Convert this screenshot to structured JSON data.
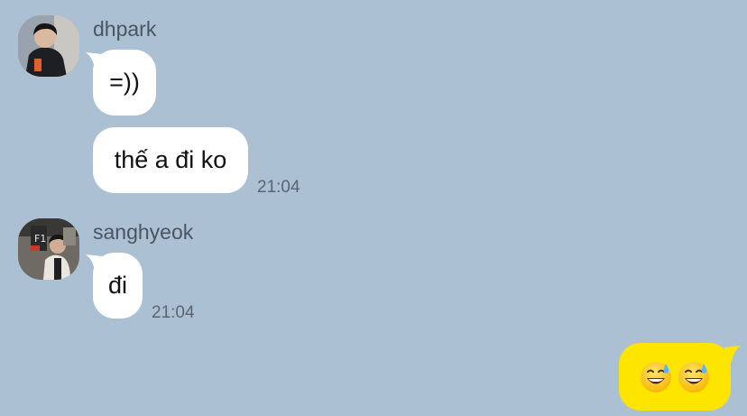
{
  "messages": [
    {
      "sender": "dhpark",
      "bubbles": [
        {
          "text": "=))"
        },
        {
          "text": "thế a đi ko",
          "time": "21:04"
        }
      ]
    },
    {
      "sender": "sanghyeok",
      "bubbles": [
        {
          "text": "đi",
          "time": "21:04"
        }
      ]
    }
  ],
  "outgoing": {
    "emojis": [
      "grinning-sweat-emoji",
      "grinning-sweat-emoji"
    ]
  },
  "colors": {
    "background": "#abc0d3",
    "incoming_bubble": "#ffffff",
    "outgoing_bubble": "#fee500",
    "sender_name": "#4b5561",
    "timestamp": "#5b6570"
  }
}
